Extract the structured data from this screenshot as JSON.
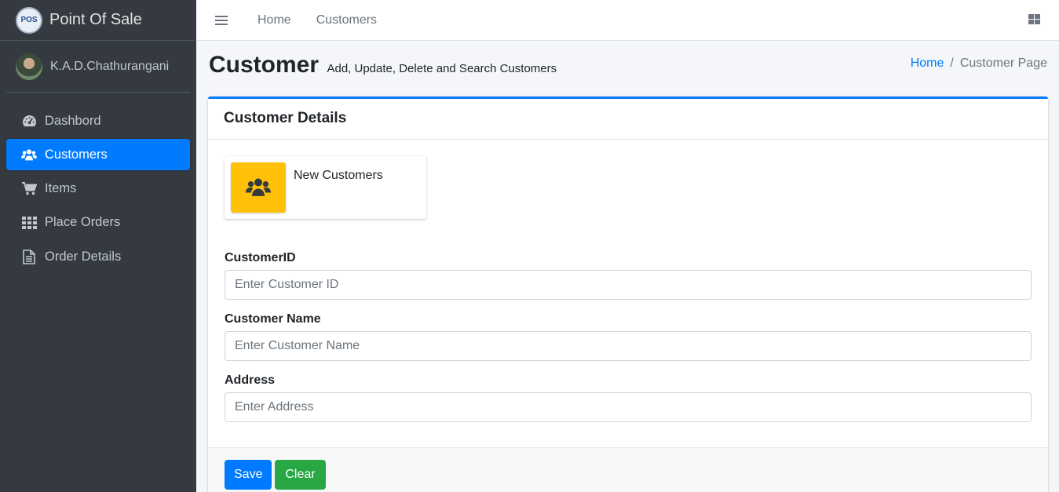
{
  "brand": {
    "logo_text": "POS",
    "name": "Point Of Sale"
  },
  "user": {
    "name": "K.A.D.Chathurangani"
  },
  "sidebar": {
    "items": [
      {
        "label": "Dashbord",
        "icon": "tachometer-icon",
        "active": false
      },
      {
        "label": "Customers",
        "icon": "users-icon",
        "active": true
      },
      {
        "label": "Items",
        "icon": "cart-icon",
        "active": false
      },
      {
        "label": "Place Orders",
        "icon": "grid-icon",
        "active": false
      },
      {
        "label": "Order Details",
        "icon": "document-icon",
        "active": false
      }
    ]
  },
  "topbar": {
    "links": [
      "Home",
      "Customers"
    ]
  },
  "header": {
    "title": "Customer",
    "subtitle": "Add, Update, Delete and Search Customers",
    "breadcrumb": {
      "home": "Home",
      "separator": "/",
      "current": "Customer Page"
    }
  },
  "card": {
    "title": "Customer Details",
    "info_box": {
      "label": "New Customers",
      "icon": "users-icon"
    },
    "fields": {
      "customer_id": {
        "label": "CustomerID",
        "placeholder": "Enter Customer ID",
        "value": ""
      },
      "customer_name": {
        "label": "Customer Name",
        "placeholder": "Enter Customer Name",
        "value": ""
      },
      "address": {
        "label": "Address",
        "placeholder": "Enter Address",
        "value": ""
      }
    },
    "buttons": {
      "save": "Save",
      "clear": "Clear"
    }
  },
  "colors": {
    "primary": "#007bff",
    "success": "#28a745",
    "warning": "#ffc107",
    "sidebar": "#343a40"
  }
}
